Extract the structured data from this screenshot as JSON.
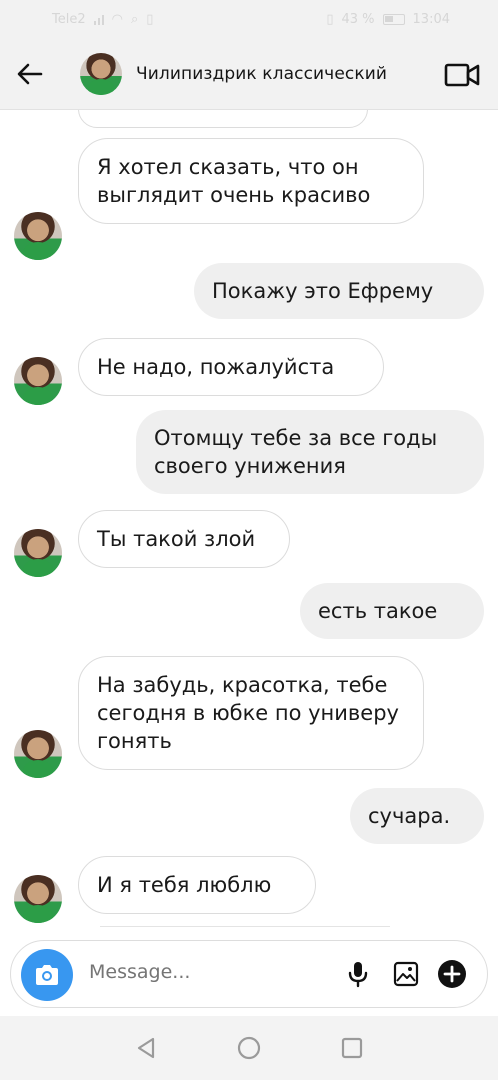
{
  "status_bar": {
    "carrier": "Tele2",
    "battery": "43 %",
    "time": "13:04"
  },
  "header": {
    "title": "Чилипиздрик классический",
    "back_icon": "arrow-left-icon",
    "video_icon": "video-camera-icon"
  },
  "messages": [
    {
      "from": "them",
      "text": "Я хотел сказать, что он выглядит очень красиво"
    },
    {
      "from": "me",
      "text": "Покажу это Ефрему"
    },
    {
      "from": "them",
      "text": "Не надо, пожалуйста"
    },
    {
      "from": "me",
      "text": "Отомщу тебе за все годы своего унижения"
    },
    {
      "from": "them",
      "text": "Ты такой злой"
    },
    {
      "from": "me",
      "text": "есть такое"
    },
    {
      "from": "them",
      "text": "На забудь, красотка, тебе сегодня в юбке по универу гонять"
    },
    {
      "from": "me",
      "text": "сучара."
    },
    {
      "from": "them",
      "text": "И я тебя люблю"
    }
  ],
  "composer": {
    "placeholder": "Message...",
    "camera_icon": "camera-icon",
    "mic_icon": "microphone-icon",
    "gallery_icon": "image-icon",
    "add_icon": "plus-circle-icon"
  },
  "nav": {
    "back_icon": "triangle-back-icon",
    "home_icon": "circle-home-icon",
    "recents_icon": "square-recents-icon"
  },
  "colors": {
    "accent": "#3897f0",
    "outgoing_bubble": "#efefef",
    "incoming_border": "#dcdcdc"
  }
}
